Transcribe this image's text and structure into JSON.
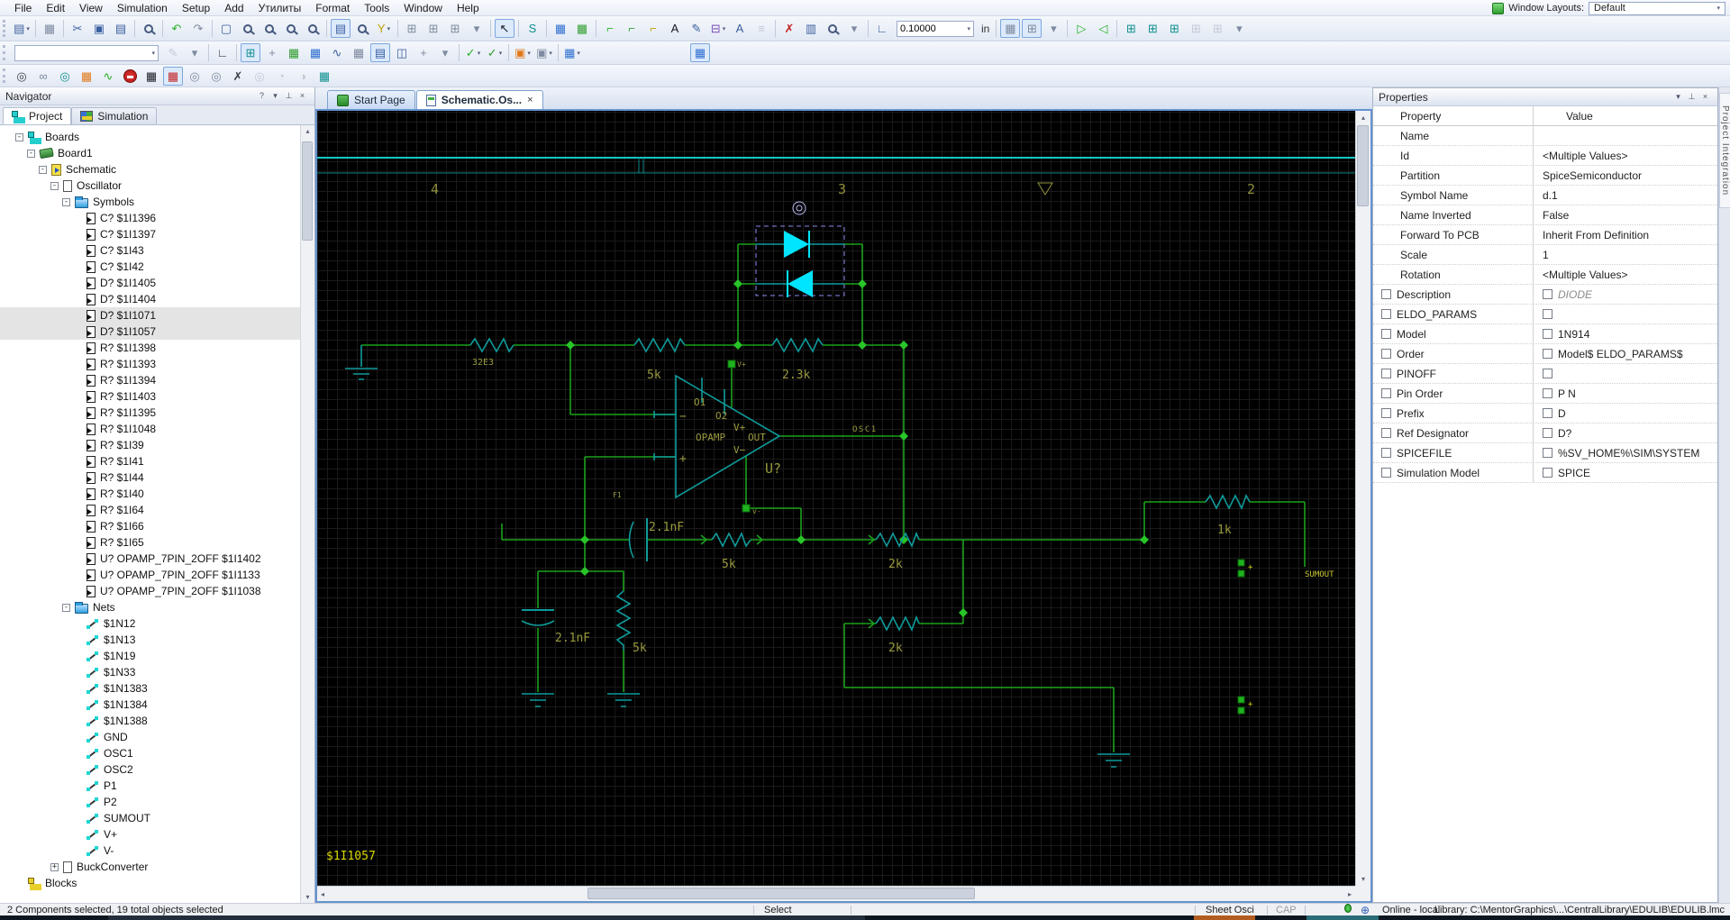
{
  "ui": {
    "dd": "▾",
    "up": "▴",
    "down": "▾",
    "left": "◂",
    "right": "▸",
    "crosshair": "⊕",
    "help": "?",
    "pin": "⊥",
    "close": "×",
    "minus": "-",
    "plus": "+"
  },
  "menu": {
    "items": [
      "File",
      "Edit",
      "View",
      "Simulation",
      "Setup",
      "Add",
      "Утилиты",
      "Format",
      "Tools",
      "Window",
      "Help"
    ]
  },
  "window_layouts": {
    "label": "Window Layouts:",
    "value": "Default"
  },
  "toolbars": {
    "row1": [
      {
        "n": "paste-special",
        "g": "▤",
        "c": "cb",
        "dd": 1
      },
      {
        "sep": 1
      },
      {
        "n": "print",
        "g": "▦",
        "c": "cm"
      },
      {
        "sep": 1
      },
      {
        "n": "cut",
        "g": "✂",
        "c": "cb"
      },
      {
        "n": "copy",
        "g": "▣",
        "c": "cb"
      },
      {
        "n": "paste",
        "g": "▤",
        "c": "cb"
      },
      {
        "sep": 1
      },
      {
        "n": "find",
        "mag": 1
      },
      {
        "sep": 1
      },
      {
        "n": "undo",
        "g": "↶",
        "c": "cG2"
      },
      {
        "n": "redo",
        "g": "↷",
        "c": "cm"
      },
      {
        "sep": 1
      },
      {
        "n": "zoom-full",
        "g": "▢",
        "c": "cb"
      },
      {
        "n": "zoom-in",
        "mag": 1
      },
      {
        "n": "zoom-out",
        "mag": 1
      },
      {
        "n": "zoom-area",
        "mag": 1
      },
      {
        "n": "zoom-select",
        "mag": 1
      },
      {
        "sep": 1
      },
      {
        "n": "properties-dialog",
        "g": "▤",
        "c": "cb",
        "box": 1
      },
      {
        "n": "doc-find",
        "mag": 1
      },
      {
        "n": "filter",
        "g": "Y",
        "c": "cy",
        "dd": 1
      },
      {
        "sep": 1
      },
      {
        "n": "link-up",
        "g": "⊞",
        "c": "cm"
      },
      {
        "n": "link-down",
        "g": "⊞",
        "c": "cm"
      },
      {
        "n": "link-all",
        "g": "⊞",
        "c": "cm"
      },
      {
        "n": "overflow-1",
        "g": "▾",
        "c": "cm"
      },
      {
        "sep": 1
      },
      {
        "n": "select-mode",
        "g": "↖",
        "c": "ck",
        "box": 1
      },
      {
        "sep": 1
      },
      {
        "n": "signal-mode",
        "g": "S",
        "c": "ct"
      },
      {
        "sep": 1
      },
      {
        "n": "chip-blue",
        "g": "▦",
        "c": "cB"
      },
      {
        "n": "chip-green",
        "g": "▦",
        "c": "cG"
      },
      {
        "sep": 1
      },
      {
        "n": "add-net",
        "g": "⌐",
        "c": "cG2"
      },
      {
        "n": "add-net-ortho",
        "g": "⌐",
        "c": "cG"
      },
      {
        "n": "add-net-any",
        "g": "⌐",
        "c": "cy"
      },
      {
        "n": "add-text",
        "g": "A",
        "c": "ck"
      },
      {
        "n": "net-name",
        "g": "✎",
        "c": "cb"
      },
      {
        "n": "add-bus",
        "g": "⊟",
        "c": "cp",
        "dd": 1
      },
      {
        "n": "annotate",
        "g": "A",
        "c": "cb"
      },
      {
        "n": "rename-ref",
        "g": "≡",
        "c": "cm",
        "gray": 1
      },
      {
        "sep": 1
      },
      {
        "n": "delete",
        "g": "✗",
        "c": "cr"
      },
      {
        "n": "add-part",
        "g": "▥",
        "c": "cb"
      },
      {
        "n": "find-part",
        "mag": 1
      },
      {
        "n": "overflow-2",
        "g": "▾",
        "c": "cm"
      },
      {
        "sep": 1
      },
      {
        "n": "snap-grid",
        "g": "∟",
        "c": "cb"
      },
      {
        "n": "grid-size-combo",
        "combo": 1,
        "val": "0.10000",
        "w": 86
      },
      {
        "n": "units",
        "lab": "in"
      },
      {
        "sep": 1
      },
      {
        "n": "grid-dots",
        "g": "▦",
        "c": "cm",
        "box": 1
      },
      {
        "n": "grid-snap",
        "g": "⊞",
        "c": "cm",
        "box": 1
      },
      {
        "n": "overflow-3",
        "g": "▾",
        "c": "cm"
      },
      {
        "sep": 1
      },
      {
        "n": "flip-horizontal",
        "g": "▷",
        "c": "cG2"
      },
      {
        "n": "flip-vertical",
        "g": "◁",
        "c": "cG2"
      },
      {
        "sep": 1
      },
      {
        "n": "align-top",
        "g": "⊞",
        "c": "ct"
      },
      {
        "n": "align-middle",
        "g": "⊞",
        "c": "ct"
      },
      {
        "n": "align-bottom",
        "g": "⊞",
        "c": "ct"
      },
      {
        "n": "align-left",
        "g": "⊞",
        "c": "cm",
        "gray": 1
      },
      {
        "n": "align-right",
        "g": "⊞",
        "c": "cm",
        "gray": 1
      },
      {
        "n": "overflow-4",
        "g": "▾",
        "c": "cm"
      }
    ],
    "row2": [
      {
        "n": "selection-filter-combo",
        "combo": 1,
        "val": "",
        "w": 160
      },
      {
        "n": "filter-edit",
        "g": "✎",
        "c": "cm",
        "gray": 1
      },
      {
        "n": "overflow-5",
        "g": "▾",
        "c": "cm"
      },
      {
        "sep": 1
      },
      {
        "n": "corner-mode",
        "g": "∟",
        "c": "cd"
      },
      {
        "sep": 1
      },
      {
        "n": "navigator-view",
        "g": "⊞",
        "c": "ct",
        "box": 1
      },
      {
        "n": "tools-view",
        "g": "+",
        "c": "cm"
      },
      {
        "n": "databook-view",
        "g": "▦",
        "c": "cG"
      },
      {
        "n": "part-view",
        "g": "▦",
        "c": "cB"
      },
      {
        "n": "waveform-view",
        "g": "∿",
        "c": "cb"
      },
      {
        "n": "grid-report-view",
        "g": "▦",
        "c": "cm"
      },
      {
        "n": "output-view",
        "g": "▤",
        "c": "cb",
        "box": 1
      },
      {
        "n": "split-view",
        "g": "◫",
        "c": "cb"
      },
      {
        "n": "pan-view",
        "g": "+",
        "c": "cm"
      },
      {
        "n": "overflow-6",
        "g": "▾",
        "c": "cm"
      },
      {
        "sep": 1
      },
      {
        "n": "verify",
        "g": "✓",
        "c": "cG2",
        "dd": 1
      },
      {
        "n": "verify-all",
        "g": "✓",
        "c": "cG",
        "dd": 1
      },
      {
        "sep": 1
      },
      {
        "n": "settings-sim",
        "g": "▣",
        "c": "co",
        "dd": 1
      },
      {
        "n": "settings-tool",
        "g": "▣",
        "c": "cm",
        "dd": 1
      },
      {
        "sep": 1
      },
      {
        "n": "package",
        "g": "▦",
        "c": "cB",
        "dd": 1
      },
      {
        "gap": 118
      },
      {
        "n": "ecu-view",
        "g": "▦",
        "c": "cB",
        "box": 1
      }
    ],
    "row3": [
      {
        "n": "probe-net",
        "g": "◎",
        "c": "cd"
      },
      {
        "n": "inspect",
        "g": "∞",
        "c": "cm"
      },
      {
        "n": "probe-pin",
        "g": "◎",
        "c": "ct"
      },
      {
        "n": "palette",
        "g": "▦",
        "c": "co"
      },
      {
        "n": "run-analysis",
        "g": "∿",
        "c": "cG2"
      },
      {
        "n": "stop-sim",
        "stop": 1
      },
      {
        "n": "xy-scope",
        "g": "▦",
        "c": "ck"
      },
      {
        "n": "sim-setup",
        "g": "▦",
        "c": "cr",
        "box": 1
      },
      {
        "n": "probe-voltage",
        "g": "◎",
        "c": "cm"
      },
      {
        "n": "probe-current",
        "g": "◎",
        "c": "cm"
      },
      {
        "n": "unprobe",
        "g": "✗",
        "c": "cd"
      },
      {
        "n": "probe-power",
        "g": "◎",
        "c": "cm",
        "gray": 1
      },
      {
        "n": "meter-1",
        "g": "◔",
        "c": "cm",
        "gray": 1
      },
      {
        "n": "meter-2",
        "g": "◑",
        "c": "cm",
        "gray": 1
      },
      {
        "n": "chart-view",
        "g": "▦",
        "c": "ct"
      }
    ]
  },
  "navigator": {
    "title": "Navigator",
    "header_buttons": [
      "?",
      "▾",
      "⊥",
      "×"
    ],
    "tabs": [
      "Project",
      "Simulation"
    ],
    "tree": [
      {
        "lvl": 1,
        "icon": "tree",
        "exp": "-",
        "label": "Boards"
      },
      {
        "lvl": 2,
        "icon": "board",
        "exp": "-",
        "label": "Board1"
      },
      {
        "lvl": 3,
        "icon": "schem",
        "exp": "-",
        "label": "Schematic"
      },
      {
        "lvl": 4,
        "icon": "page",
        "exp": "-",
        "label": "Oscillator"
      },
      {
        "lvl": 5,
        "icon": "folder",
        "exp": "-",
        "label": "Symbols"
      },
      {
        "lvl": 6,
        "icon": "comp",
        "label": "C?  $1I1396"
      },
      {
        "lvl": 6,
        "icon": "comp",
        "label": "C?  $1I1397"
      },
      {
        "lvl": 6,
        "icon": "comp",
        "label": "C?  $1I43"
      },
      {
        "lvl": 6,
        "icon": "comp",
        "label": "C?  $1I42"
      },
      {
        "lvl": 6,
        "icon": "comp",
        "label": "D?  $1I1405"
      },
      {
        "lvl": 6,
        "icon": "comp",
        "label": "D?  $1I1404"
      },
      {
        "lvl": 6,
        "icon": "comp",
        "label": "D?  $1I1071",
        "sel": 1
      },
      {
        "lvl": 6,
        "icon": "comp",
        "label": "D?  $1I1057",
        "sel": 1
      },
      {
        "lvl": 6,
        "icon": "comp",
        "label": "R?  $1I1398"
      },
      {
        "lvl": 6,
        "icon": "comp",
        "label": "R?  $1I1393"
      },
      {
        "lvl": 6,
        "icon": "comp",
        "label": "R?  $1I1394"
      },
      {
        "lvl": 6,
        "icon": "comp",
        "label": "R?  $1I1403"
      },
      {
        "lvl": 6,
        "icon": "comp",
        "label": "R?  $1I1395"
      },
      {
        "lvl": 6,
        "icon": "comp",
        "label": "R?  $1I1048"
      },
      {
        "lvl": 6,
        "icon": "comp",
        "label": "R?  $1I39"
      },
      {
        "lvl": 6,
        "icon": "comp",
        "label": "R?  $1I41"
      },
      {
        "lvl": 6,
        "icon": "comp",
        "label": "R?  $1I44"
      },
      {
        "lvl": 6,
        "icon": "comp",
        "label": "R?  $1I40"
      },
      {
        "lvl": 6,
        "icon": "comp",
        "label": "R?  $1I64"
      },
      {
        "lvl": 6,
        "icon": "comp",
        "label": "R?  $1I66"
      },
      {
        "lvl": 6,
        "icon": "comp",
        "label": "R?  $1I65"
      },
      {
        "lvl": 6,
        "icon": "comp",
        "label": "U? OPAMP_7PIN_2OFF $1I1402"
      },
      {
        "lvl": 6,
        "icon": "comp",
        "label": "U? OPAMP_7PIN_2OFF $1I1133"
      },
      {
        "lvl": 6,
        "icon": "comp",
        "label": "U? OPAMP_7PIN_2OFF $1I1038"
      },
      {
        "lvl": 5,
        "icon": "folder",
        "exp": "-",
        "label": "Nets"
      },
      {
        "lvl": 6,
        "icon": "net",
        "label": "$1N12"
      },
      {
        "lvl": 6,
        "icon": "net",
        "label": "$1N13"
      },
      {
        "lvl": 6,
        "icon": "net",
        "label": "$1N19"
      },
      {
        "lvl": 6,
        "icon": "net",
        "label": "$1N33"
      },
      {
        "lvl": 6,
        "icon": "net",
        "label": "$1N1383"
      },
      {
        "lvl": 6,
        "icon": "net",
        "label": "$1N1384"
      },
      {
        "lvl": 6,
        "icon": "net",
        "label": "$1N1388"
      },
      {
        "lvl": 6,
        "icon": "net",
        "label": "GND"
      },
      {
        "lvl": 6,
        "icon": "net",
        "label": "OSC1"
      },
      {
        "lvl": 6,
        "icon": "net",
        "label": "OSC2"
      },
      {
        "lvl": 6,
        "icon": "net",
        "label": "P1"
      },
      {
        "lvl": 6,
        "icon": "net",
        "label": "P2"
      },
      {
        "lvl": 6,
        "icon": "net",
        "label": "SUMOUT"
      },
      {
        "lvl": 6,
        "icon": "net",
        "label": "V+"
      },
      {
        "lvl": 6,
        "icon": "net",
        "label": "V-"
      },
      {
        "lvl": 4,
        "icon": "page",
        "exp": "+",
        "label": "BuckConverter"
      },
      {
        "lvl": 1,
        "icon": "blocks",
        "label": "Blocks"
      }
    ]
  },
  "doc_tabs": [
    {
      "label": "Start Page"
    },
    {
      "label": "Schematic.Os...",
      "close_glyph": "×"
    }
  ],
  "schematic": {
    "zones": {
      "z4": "4",
      "z3": "3",
      "z2": "2"
    },
    "labels": {
      "r_fb": "32E3",
      "r_in": "5k",
      "r_par": "2.3k",
      "pin_o1": "O1",
      "pin_o2": "O2",
      "pin_vp": "V+",
      "pin_out": "OUT",
      "pin_vm": "V−",
      "opamp": "OPAMP",
      "ref": "U?",
      "minus": "−",
      "plus": "+",
      "net_osc1": "OSC1",
      "cap_fb": "2.1nF",
      "r_sum_a": "5k",
      "r_sum_b": "2k",
      "cap_gnd": "2.1nF",
      "r_gnd": "5k",
      "r_fb2": "2k",
      "r_out": "1k",
      "net_sumout": "SUMOUT",
      "flag": "F1",
      "term_vp": "V+",
      "term_vm": "v-",
      "conn_plus_a": "+",
      "conn_plus_b": "+",
      "sheet_ref": "$1I1057"
    }
  },
  "properties": {
    "title": "Properties",
    "header_buttons": [
      "▾",
      "⊥",
      "×"
    ],
    "columns": [
      "Property",
      "Value"
    ],
    "rows": [
      {
        "p": "Name",
        "v": ""
      },
      {
        "p": "Id",
        "v": "<Multiple Values>"
      },
      {
        "p": "Partition",
        "v": "SpiceSemiconductor"
      },
      {
        "p": "Symbol Name",
        "v": "d.1"
      },
      {
        "p": "Name Inverted",
        "v": "False"
      },
      {
        "p": "Forward To PCB",
        "v": "Inherit From Definition"
      },
      {
        "p": "Scale",
        "v": "1"
      },
      {
        "p": "Rotation",
        "v": "<Multiple Values>"
      },
      {
        "p": "Description",
        "v": "DIODE",
        "cb": 1,
        "vcb": 1,
        "italic": 1
      },
      {
        "p": "ELDO_PARAMS",
        "v": "",
        "cb": 1,
        "vcb": 1
      },
      {
        "p": "Model",
        "v": "1N914",
        "cb": 1,
        "vcb": 1
      },
      {
        "p": "Order",
        "v": "Model$ ELDO_PARAMS$",
        "cb": 1,
        "vcb": 1
      },
      {
        "p": "PINOFF",
        "v": "",
        "cb": 1,
        "vcb": 1
      },
      {
        "p": "Pin Order",
        "v": "P N",
        "cb": 1,
        "vcb": 1
      },
      {
        "p": "Prefix",
        "v": "D",
        "cb": 1,
        "vcb": 1
      },
      {
        "p": "Ref Designator",
        "v": "D?",
        "cb": 1,
        "vcb": 1
      },
      {
        "p": "SPICEFILE",
        "v": "%SV_HOME%\\SIM\\SYSTEM",
        "cb": 1,
        "vcb": 1
      },
      {
        "p": "Simulation Model",
        "v": "SPICE",
        "cb": 1,
        "vcb": 1
      }
    ]
  },
  "right_strip": {
    "label": "Project Integration"
  },
  "status": {
    "selection": "2 Components selected, 19 total objects selected",
    "mode": "Select",
    "sheet": "Sheet Osci",
    "sheet_suffix": "CAP",
    "online": "Online - local",
    "library": "Library: C:\\MentorGraphics\\...\\CentralLibrary\\EDULIB\\EDULIB.lmc"
  }
}
